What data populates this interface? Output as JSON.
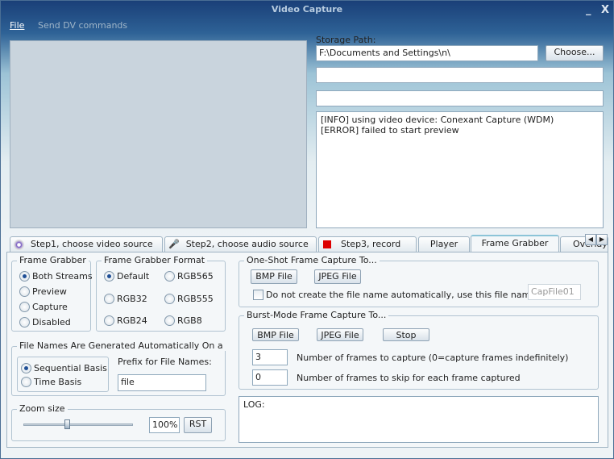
{
  "window": {
    "title": "Video Capture",
    "minimize": "_",
    "close": "X"
  },
  "menu": [
    {
      "label": "File",
      "enabled": true
    },
    {
      "label": "Send DV commands",
      "enabled": false
    }
  ],
  "storage": {
    "label": "Storage Path:",
    "value": "F:\\Documents and Settings\\n\\",
    "choose": "Choose...",
    "field2": "",
    "field3": ""
  },
  "log_top": [
    "[INFO] using video device: Conexant Capture (WDM)",
    "[ERROR] failed to start preview"
  ],
  "tabs": [
    {
      "label": "Step1, choose video source",
      "icon": "webcam-icon"
    },
    {
      "label": "Step2, choose audio source",
      "icon": "microphone-icon"
    },
    {
      "label": "Step3, record",
      "icon": "record-icon"
    },
    {
      "label": "Player"
    },
    {
      "label": "Frame Grabber",
      "active": true
    },
    {
      "label": "Overlays"
    }
  ],
  "frame_grabber": {
    "title": "Frame Grabber",
    "options": [
      "Both Streams",
      "Preview",
      "Capture",
      "Disabled"
    ],
    "selected": "Both Streams"
  },
  "format": {
    "title": "Frame Grabber Format",
    "options": [
      "Default",
      "RGB565",
      "RGB32",
      "RGB555",
      "RGB24",
      "RGB8"
    ],
    "selected": "Default"
  },
  "filenames": {
    "title": "File Names Are Generated Automatically On a",
    "options": [
      "Sequential Basis",
      "Time Basis"
    ],
    "selected": "Sequential Basis",
    "prefix_label": "Prefix for File Names:",
    "prefix_value": "file"
  },
  "zoom": {
    "title": "Zoom size",
    "value": "100%",
    "slider_percent": 40,
    "reset": "RST"
  },
  "oneshot": {
    "title": "One-Shot Frame Capture To...",
    "bmp": "BMP File",
    "jpeg": "JPEG File",
    "checkbox_label": "Do not create the file name automatically, use this file name:",
    "checked": false,
    "filename": "CapFile01"
  },
  "burst": {
    "title": "Burst-Mode Frame Capture To...",
    "bmp": "BMP File",
    "jpeg": "JPEG File",
    "stop": "Stop",
    "frames_value": "3",
    "frames_label": "Number of frames to capture (0=capture frames indefinitely)",
    "skip_value": "0",
    "skip_label": "Number of frames to skip for each frame captured"
  },
  "log": {
    "label": "LOG:"
  }
}
